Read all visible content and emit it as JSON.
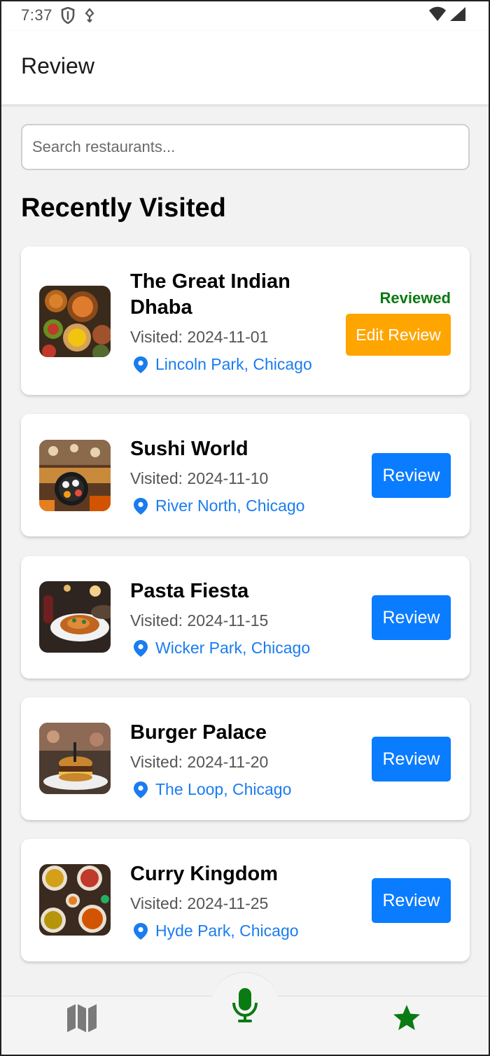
{
  "status_bar": {
    "time": "7:37",
    "icons": [
      "shield-icon",
      "usb-icon",
      "wifi-icon",
      "signal-icon"
    ]
  },
  "app_bar": {
    "title": "Review"
  },
  "search": {
    "placeholder": "Search restaurants...",
    "value": ""
  },
  "section": {
    "title": "Recently Visited"
  },
  "restaurants": [
    {
      "name": "The Great Indian Dhaba",
      "visited": "Visited: 2024-11-01",
      "location": "Lincoln Park, Chicago",
      "status": "Reviewed",
      "action": "Edit Review"
    },
    {
      "name": "Sushi World",
      "visited": "Visited: 2024-11-10",
      "location": "River North, Chicago",
      "action": "Review"
    },
    {
      "name": "Pasta Fiesta",
      "visited": "Visited: 2024-11-15",
      "location": "Wicker Park, Chicago",
      "action": "Review"
    },
    {
      "name": "Burger Palace",
      "visited": "Visited: 2024-11-20",
      "location": "The Loop, Chicago",
      "action": "Review"
    },
    {
      "name": "Curry Kingdom",
      "visited": "Visited: 2024-11-25",
      "location": "Hyde Park, Chicago",
      "action": "Review"
    }
  ],
  "bottom_nav": {
    "items": [
      "map-icon",
      "microphone-icon",
      "star-icon"
    ]
  },
  "colors": {
    "primary": "#0a7cff",
    "edit": "#ffa500",
    "reviewed": "#0a7a12",
    "location": "#1a7cf0",
    "nav_active": "#0a7a12"
  }
}
